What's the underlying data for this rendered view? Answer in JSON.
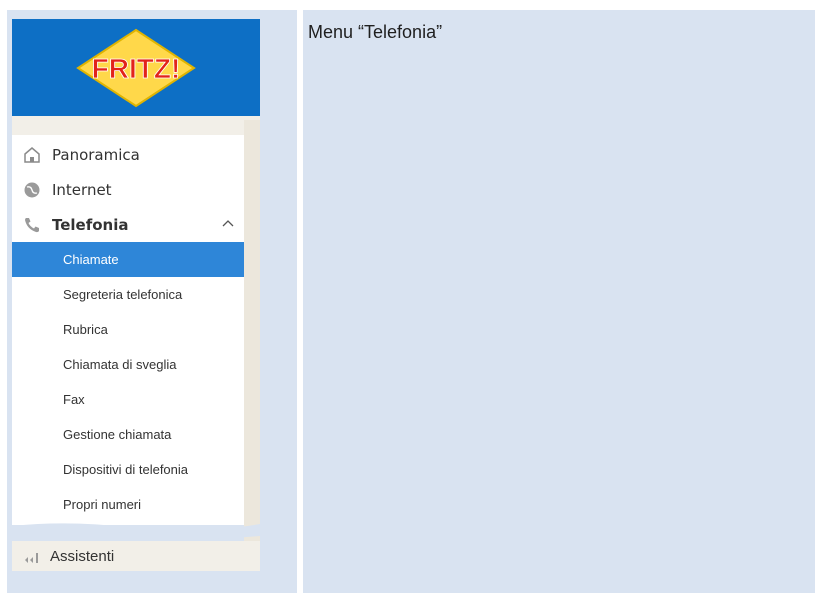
{
  "header": {
    "menu_title": "Menu “Telefonia”"
  },
  "logo": {
    "text": "FRITZ!"
  },
  "nav": {
    "items": [
      {
        "label": "Panoramica",
        "icon": "home-icon"
      },
      {
        "label": "Internet",
        "icon": "globe-icon"
      },
      {
        "label": "Telefonia",
        "icon": "phone-icon",
        "expanded": true
      }
    ],
    "telefonia_sub": [
      {
        "label": "Chiamate",
        "active": true
      },
      {
        "label": "Segreteria telefonica"
      },
      {
        "label": "Rubrica"
      },
      {
        "label": "Chiamata di sveglia"
      },
      {
        "label": "Fax"
      },
      {
        "label": "Gestione chiamata"
      },
      {
        "label": "Dispositivi di telefonia"
      },
      {
        "label": "Propri numeri"
      }
    ],
    "assistenti": {
      "label": "Assistenti",
      "icon": "wizard-icon"
    }
  },
  "colors": {
    "accent": "#2e86d8",
    "logo_bg": "#0d6fc5",
    "panel_bg": "#d9e3f1"
  }
}
